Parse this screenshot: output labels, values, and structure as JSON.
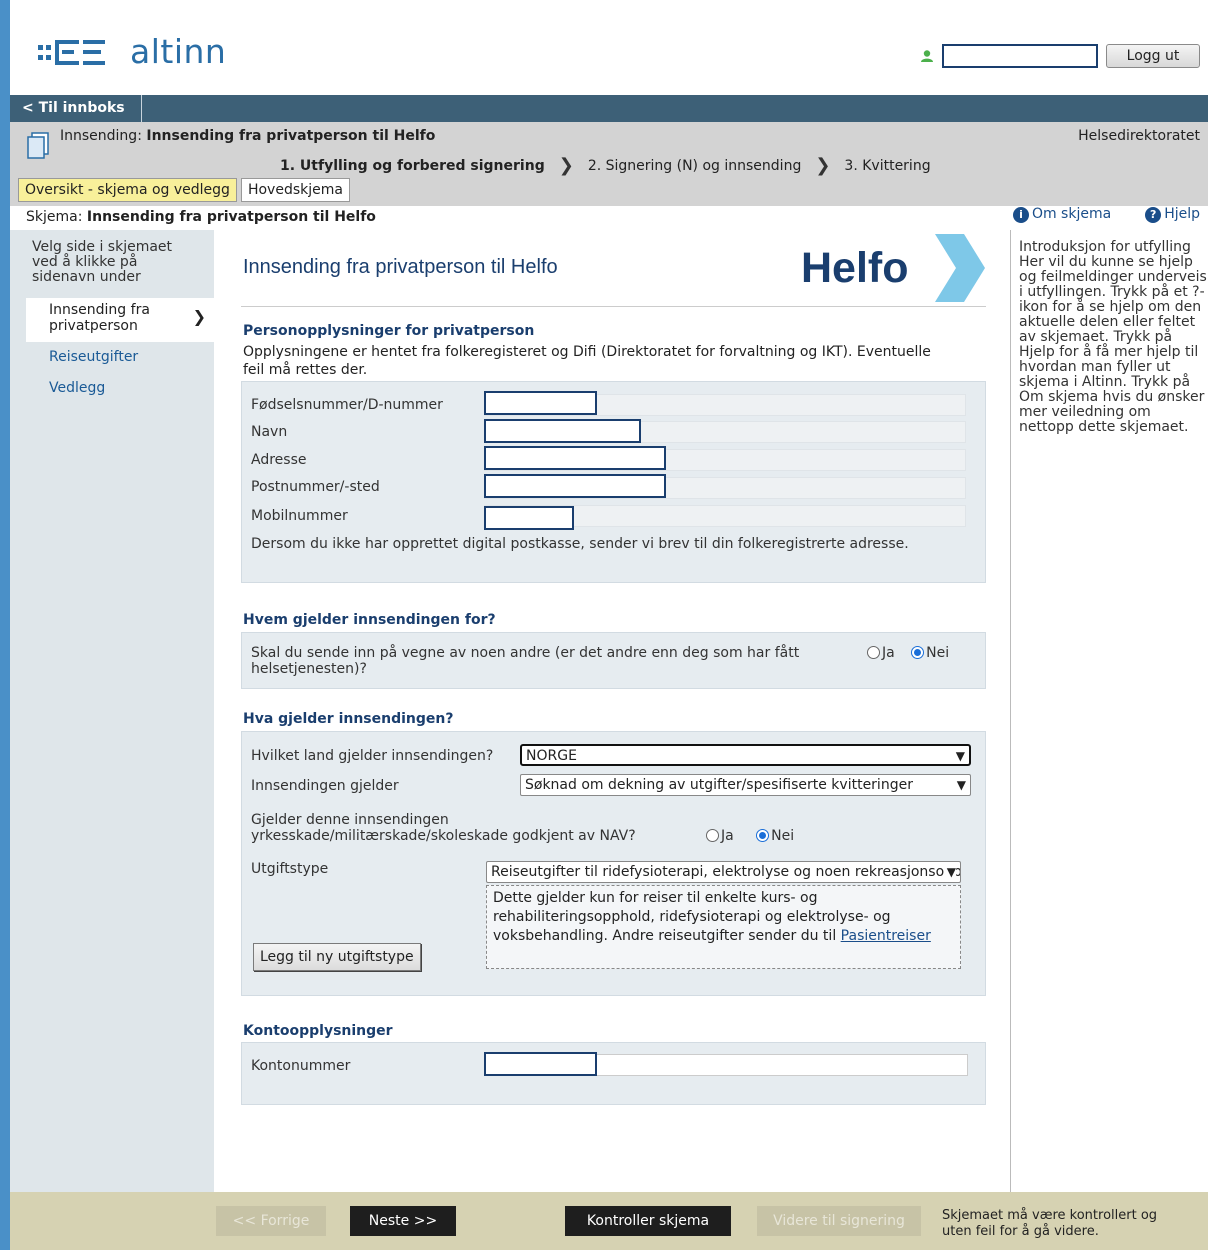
{
  "header": {
    "logo_text": "altinn",
    "logout_label": "Logg ut"
  },
  "nav": {
    "back_label": "< Til innboks"
  },
  "submission": {
    "prefix": "Innsending: ",
    "title": "Innsending fra privatperson til Helfo",
    "department": "Helsedirektoratet",
    "steps": [
      "1. Utfylling og forbered signering",
      "2. Signering (N) og innsending",
      "3. Kvittering"
    ],
    "tabs": [
      "Oversikt - skjema og vedlegg",
      "Hovedskjema"
    ]
  },
  "skjema_line": {
    "prefix": "Skjema: ",
    "title": "Innsending fra privatperson til Helfo",
    "about_label": "Om skjema",
    "help_label": "Hjelp"
  },
  "sidenav": {
    "intro": "Velg side i skjemaet ved å klikke på sidenavn under",
    "items": [
      "Innsending fra privatperson",
      "Reiseutgifter",
      "Vedlegg"
    ]
  },
  "form": {
    "title": "Innsending fra privatperson til Helfo",
    "helfo_logo": "Helfo",
    "person": {
      "heading": "Personopplysninger for privatperson",
      "desc": "Opplysningene er hentet fra folkeregisteret og Difi (Direktoratet for forvaltning og IKT). Eventuelle feil må rettes der.",
      "fields": [
        {
          "label": "Fødselsnummer/D-nummer",
          "value": ""
        },
        {
          "label": "Navn",
          "value": ""
        },
        {
          "label": "Adresse",
          "value": ""
        },
        {
          "label": "Postnummer/-sted",
          "value": ""
        },
        {
          "label": "Mobilnummer",
          "value": ""
        }
      ],
      "note": "Dersom du ikke har opprettet digital postkasse, sender vi brev til din folkeregistrerte adresse."
    },
    "who": {
      "heading": "Hvem gjelder innsendingen for?",
      "question": "Skal du sende inn på vegne av noen andre (er det andre enn deg som har fått helsetjenesten)?",
      "yes": "Ja",
      "no": "Nei",
      "selected": "Nei"
    },
    "what": {
      "heading": "Hva gjelder innsendingen?",
      "country_label": "Hvilket land gjelder innsendingen?",
      "country_value": "NORGE",
      "concerns_label": "Innsendingen gjelder",
      "concerns_value": "Søknad om dekning av utgifter/spesifiserte kvitteringer",
      "injury_label": "Gjelder denne innsendingen yrkesskade/militærskade/skoleskade godkjent av NAV?",
      "yes": "Ja",
      "no": "Nei",
      "injury_selected": "Nei",
      "type_label": "Utgiftstype",
      "type_value": "Reiseutgifter til ridefysioterapi, elektrolyse og noen rekreasjonsopphold",
      "info_text": "Dette gjelder kun for reiser til enkelte kurs- og rehabiliteringsopphold, ridefysioterapi og elektrolyse- og voksbehandling. Andre reiseutgifter sender du til",
      "info_link": "Pasientreiser",
      "add_button": "Legg til ny utgiftstype"
    },
    "account": {
      "heading": "Kontoopplysninger",
      "label": "Kontonummer",
      "value": ""
    }
  },
  "right_help": {
    "text": "Introduksjon for utfylling Her vil du kunne se hjelp og feilmeldinger underveis i utfyllingen. Trykk på et ?- ikon for å se hjelp om den aktuelle delen eller feltet av skjemaet. Trykk på Hjelp for å få mer hjelp til hvordan man fyller ut skjema i Altinn. Trykk på Om skjema hvis du ønsker mer veiledning om nettopp dette skjemaet."
  },
  "footer": {
    "prev": "<< Forrige",
    "next": "Neste >>",
    "check": "Kontroller skjema",
    "to_sign": "Videre til signering",
    "note": "Skjemaet må være kontrollert og uten feil for å gå videre."
  },
  "colors": {
    "nav_bar": "#3d6077",
    "accent_blue": "#1a3e6e",
    "helfo_blue": "#1a3e6e",
    "helfo_chevron": "#7ec8e8"
  }
}
